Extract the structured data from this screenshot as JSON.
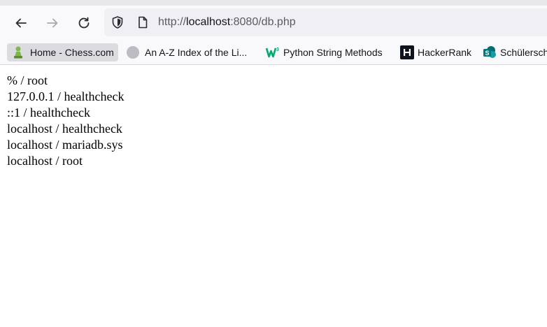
{
  "browser": {
    "url_scheme": "http://",
    "url_host": "localhost",
    "url_rest": ":8080/db.php",
    "bookmarks": [
      {
        "label": "Home - Chess.com",
        "icon": "pawn-icon"
      },
      {
        "label": "An A-Z Index of the Li...",
        "icon": "globe-icon"
      },
      {
        "label": "Python String Methods",
        "icon": "w3schools-icon"
      },
      {
        "label": "HackerRank",
        "icon": "hackerrank-icon"
      },
      {
        "label": "Schülersch",
        "icon": "sharepoint-icon"
      }
    ]
  },
  "page": {
    "lines": [
      "% / root",
      "127.0.0.1 / healthcheck",
      "::1 / healthcheck",
      "localhost / healthcheck",
      "localhost / mariadb.sys",
      "localhost / root"
    ]
  },
  "colors": {
    "toolbar_bg": "#f9f9fb",
    "urlbar_bg": "#f0f0f4",
    "active_bookmark_bg": "#dcdce0",
    "chess_green": "#81b64c",
    "w3_green": "#04aa6d",
    "sharepoint_teal": "#036c70"
  }
}
